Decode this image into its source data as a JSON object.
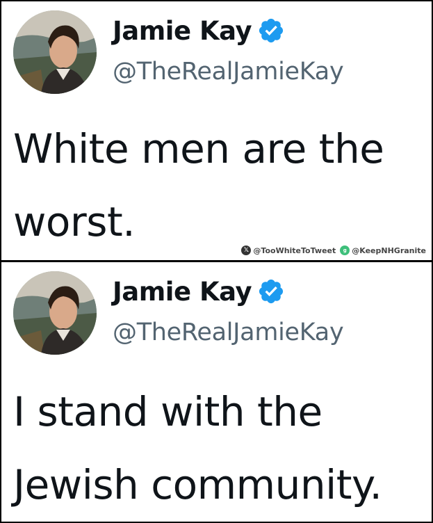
{
  "colors": {
    "name": "#0f1419",
    "handle": "#536471",
    "verified": "#1d9bf0"
  },
  "tweets": [
    {
      "display_name": "Jamie Kay",
      "handle": "@TheRealJamieKay",
      "text": "White men are the worst.",
      "verified_icon": "verified-badge-icon"
    },
    {
      "display_name": "Jamie Kay",
      "handle": "@TheRealJamieKay",
      "text": "I stand with the Jewish community.",
      "verified_icon": "verified-badge-icon"
    }
  ],
  "watermark": {
    "x_handle": "@TooWhiteToTweet",
    "gab_handle": "@KeepNHGranite",
    "x_icon": "x-logo-icon",
    "gab_icon": "gab-logo-icon"
  }
}
